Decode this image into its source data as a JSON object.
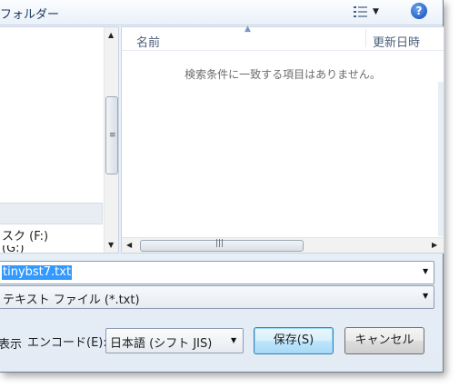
{
  "toolbar": {
    "new_folder_label": "フォルダー",
    "view_icon": "view-options-icon",
    "help_icon": "help-icon",
    "help_glyph": "?"
  },
  "nav_pane": {
    "items": [
      {
        "label": "スク (F:)"
      },
      {
        "label": "  (G:)"
      }
    ]
  },
  "file_list": {
    "columns": [
      {
        "label": "名前"
      },
      {
        "label": "更新日時"
      }
    ],
    "empty_message": "検索条件に一致する項目はありません。"
  },
  "filename": {
    "value": "tinybst7.txt"
  },
  "filetype": {
    "value": "テキスト ファイル (*.txt)"
  },
  "bottom_bar": {
    "partial_label": "表示",
    "encode_label": "エンコード(E):",
    "encode_value": "日本語 (シフト JIS)",
    "save_label": "保存(S)",
    "cancel_label": "キャンセル"
  },
  "colors": {
    "selection": "#3399ff",
    "dialog_bg": "#e3ebf5",
    "accent": "#2b64c6"
  }
}
